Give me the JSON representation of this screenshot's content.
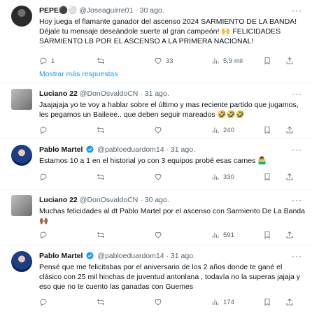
{
  "tweets": [
    {
      "name": "PEPE⚫️⚪️",
      "handle": "@Joseaguirre01",
      "time": "· 30 ago.",
      "text": "Hoy juega el flamante ganador del ascenso 2024 SARMIENTO DE LA BANDA! Déjale tu mensaje deseándole suerte al gran campeón! 🙌 FELICIDADES SARMIENTO LB POR EL ASCENSO A LA PRIMERA NACIONAL!",
      "replies": "1",
      "reposts": "",
      "likes": "33",
      "views": "5,9 mil"
    },
    {
      "name": "Luciano 22",
      "handle": "@DonOsvaldoCN",
      "time": "· 31 ago.",
      "text": "Jaajajaja yo te voy a hablar sobre el último y mas reciente partido que jugamos, les pegamos un Baileee.. que deben seguir mareados 🤣🤣🤣",
      "replies": "",
      "reposts": "",
      "likes": "",
      "views": "240"
    },
    {
      "name": "Pablo Martel",
      "handle": "@pabloeduardom14",
      "time": "· 31 ago.",
      "text": "Estamos 10 a 1 en el historial yo con 3 equipos probé esas carnes 🤷‍♂️",
      "replies": "",
      "reposts": "",
      "likes": "",
      "views": "330"
    },
    {
      "name": "Luciano 22",
      "handle": "@DonOsvaldoCN",
      "time": "· 30 ago.",
      "text": "Muchas felicidades al dt Pablo Martel por el ascenso con Sarmiento De La Banda 🙌🏾",
      "replies": "",
      "reposts": "",
      "likes": "",
      "views": "591"
    },
    {
      "name": "Pablo Martel",
      "handle": "@pabloeduardom14",
      "time": "· 31 ago.",
      "text": "Pensé que me felicitabas por el aniversario de los 2 años donde te gané el clásico con 25 mil hinchas de juventud antonlana , todavía no la superas jajaja y eso que no te cuento las ganadas con Guemes",
      "replies": "",
      "reposts": "",
      "likes": "",
      "views": "174"
    }
  ],
  "show_more": "Mostrar más respuestas",
  "colors": {
    "link": "#1d9bf0",
    "verified": "#1d9bf0",
    "muted": "#536471"
  }
}
